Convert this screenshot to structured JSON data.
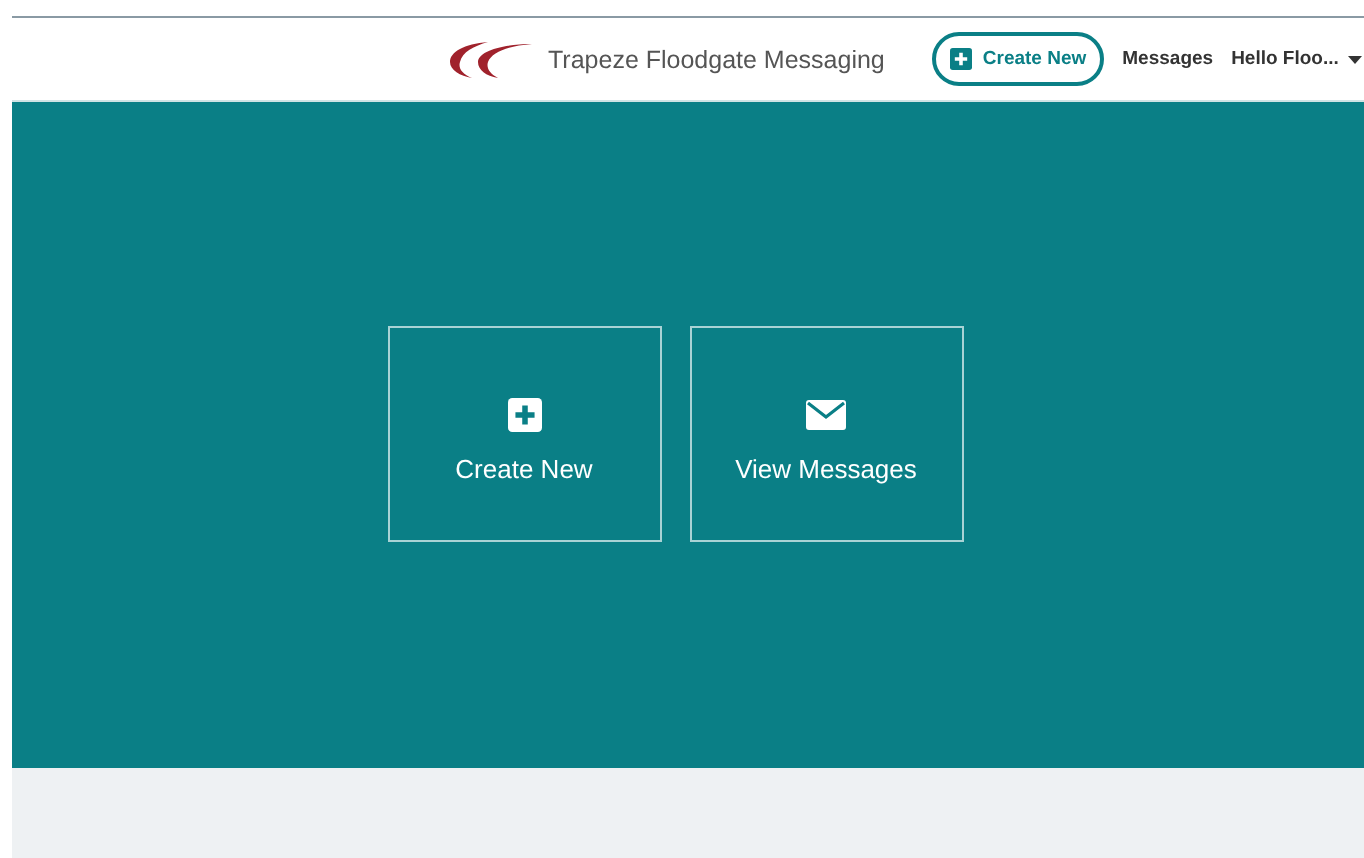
{
  "header": {
    "brand": "Trapeze Floodgate Messaging",
    "create_button": "Create New",
    "nav_link": "Messages",
    "user_menu": "Hello Floo..."
  },
  "tiles": [
    {
      "kind": "create",
      "label": "Create New"
    },
    {
      "kind": "messages",
      "label": "View Messages"
    }
  ]
}
